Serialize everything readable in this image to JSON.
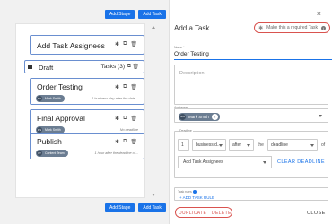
{
  "toolbar": {
    "add_stage": "Add Stage",
    "add_task": "Add Task"
  },
  "stages": {
    "assignees": {
      "title": "Add Task Assignees"
    },
    "draft": {
      "title": "Draft",
      "count": "Tasks (3)"
    },
    "order_testing": {
      "title": "Order Testing",
      "chip_initials": "MS",
      "chip_name": "Mark Smith",
      "note": "1 business day after the date..."
    },
    "final_approval": {
      "title": "Final Approval",
      "chip_initials": "MS",
      "chip_name": "Mark Smith",
      "note": "No deadline"
    },
    "publish": {
      "title": "Publish",
      "chip_initials": "CT",
      "chip_name": "Content Team",
      "note": "1 hour after the deadline of..."
    }
  },
  "panel": {
    "title": "Add a Task",
    "required_label": "Make this a required Task",
    "name_label": "Name *",
    "name_value": "Order Testing",
    "description_placeholder": "Description",
    "assignees_label": "Assignees",
    "assignee_initials": "MS",
    "assignee_name": "Mark Smith",
    "assignee_remove": "×",
    "deadline_label": "Deadline",
    "deadline_amount": "1",
    "deadline_unit": "business d...",
    "deadline_relation": "after",
    "deadline_the": "the",
    "deadline_reference": "deadline",
    "deadline_of": "of",
    "deadline_target": "Add Task Assignees",
    "clear_deadline": "CLEAR DEADLINE",
    "task_rules_label": "Task rules",
    "add_task_rule": "+ ADD TASK RULE",
    "duplicate": "DUPLICATE",
    "delete": "DELETE",
    "close": "CLOSE",
    "close_icon": "×"
  },
  "icons": {
    "close": "close-icon",
    "star": "star-icon",
    "info": "info-icon",
    "copy": "copy-icon",
    "trash": "trash-icon",
    "drag": "drag-handle-icon"
  },
  "colors": {
    "accent": "#1a73e8",
    "danger": "#d9534f",
    "chip": "#6b7d92",
    "card_border": "#6a8fd0"
  }
}
